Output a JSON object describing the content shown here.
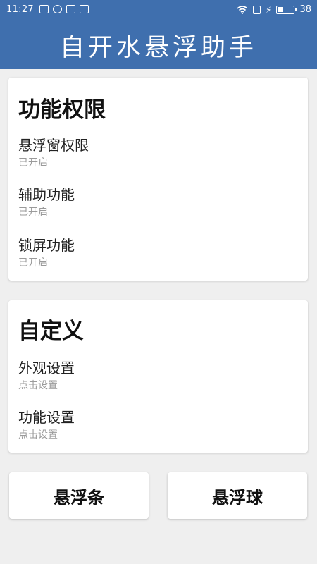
{
  "status_bar": {
    "time": "11:27",
    "battery_percent": 38,
    "battery_text": "38",
    "icons": [
      "image-icon",
      "check-circle-icon",
      "mail-icon",
      "mail-icon",
      "wifi-icon",
      "phone-icon",
      "charging-icon",
      "battery-icon"
    ]
  },
  "header": {
    "title": "自开水悬浮助手",
    "background_color": "#3f6fae"
  },
  "permissions": {
    "title": "功能权限",
    "items": [
      {
        "label": "悬浮窗权限",
        "status": "已开启"
      },
      {
        "label": "辅助功能",
        "status": "已开启"
      },
      {
        "label": "锁屏功能",
        "status": "已开启"
      }
    ]
  },
  "customize": {
    "title": "自定义",
    "items": [
      {
        "label": "外观设置",
        "status": "点击设置"
      },
      {
        "label": "功能设置",
        "status": "点击设置"
      }
    ]
  },
  "buttons": {
    "floating_bar": "悬浮条",
    "floating_ball": "悬浮球"
  }
}
